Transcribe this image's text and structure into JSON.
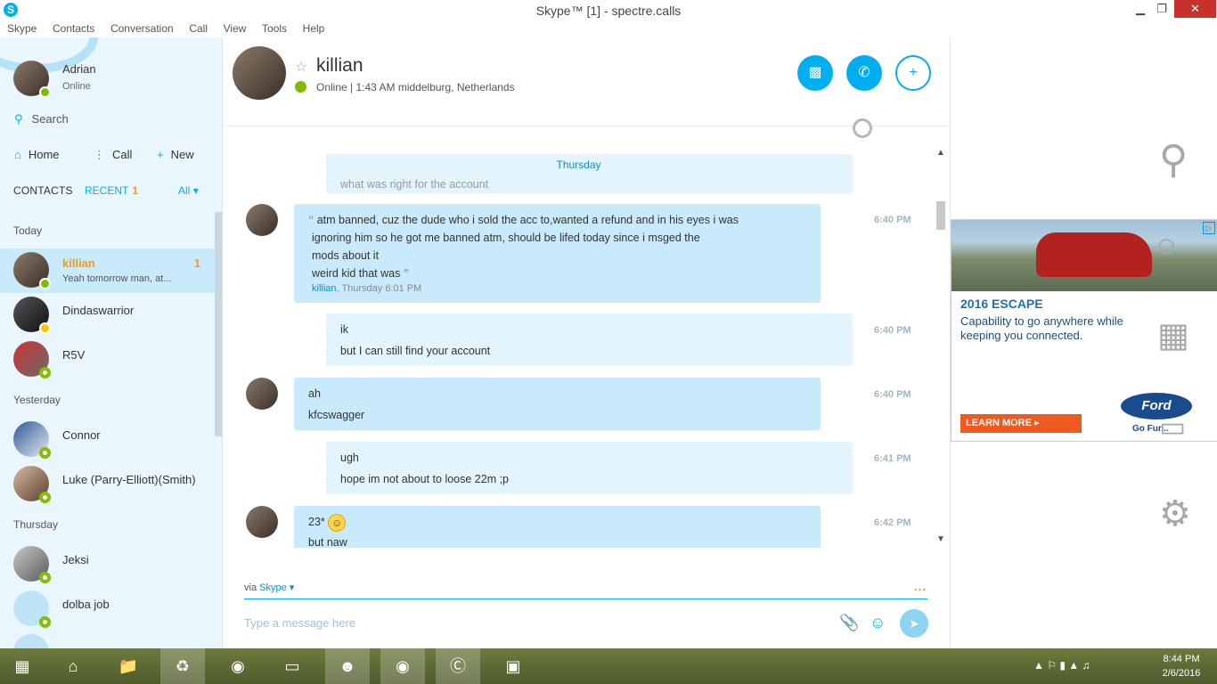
{
  "window": {
    "title": "Skype™ [1] - spectre.calls",
    "minimize": "▁",
    "maximize": "❐",
    "close": "✕"
  },
  "menu": [
    "Skype",
    "Contacts",
    "Conversation",
    "Call",
    "View",
    "Tools",
    "Help"
  ],
  "me": {
    "name": "Adrian",
    "status": "Online"
  },
  "search": {
    "label": "Search"
  },
  "nav": {
    "home": "Home",
    "call": "Call",
    "new": "New"
  },
  "tabs": {
    "contacts": "CONTACTS",
    "recent": "RECENT",
    "recent_count": "1",
    "filter": "All"
  },
  "sections": {
    "today": "Today",
    "yesterday": "Yesterday",
    "thursday": "Thursday"
  },
  "contacts": [
    {
      "name": "killian",
      "preview": "Yeah tomorrow man, at...",
      "badge": "1",
      "status": "online"
    },
    {
      "name": "Dindaswarrior",
      "status": "away"
    },
    {
      "name": "R5V",
      "status": "offline"
    },
    {
      "name": "Connor",
      "status": "offline"
    },
    {
      "name": "Luke (Parry-Elliott)(Smith)",
      "status": "offline"
    },
    {
      "name": "Jeksi",
      "status": "offline"
    },
    {
      "name": "dolba job",
      "status": "offline"
    }
  ],
  "conversation": {
    "name": "killian",
    "status": "Online",
    "detail": "1:43 AM middelburg, Netherlands",
    "day_label": "Thursday",
    "partial_top": "what was right for the account",
    "messages": [
      {
        "from": "them",
        "lines": [
          "atm banned, cuz the dude who i sold the acc to,wanted a refund and in his eyes i was",
          "ignoring him so he got me banned atm, should be lifed today since i msged the",
          "mods about it",
          "weird kid that was"
        ],
        "quote_author": "killian",
        "quote_time": "Thursday 6:01 PM",
        "time": "6:40 PM"
      },
      {
        "from": "me",
        "lines": [
          "ik",
          "but I can still find your account"
        ],
        "time": "6:40 PM"
      },
      {
        "from": "them",
        "lines": [
          "ah",
          "kfcswagger"
        ],
        "time": "6:40 PM"
      },
      {
        "from": "me",
        "lines": [
          "ugh",
          "hope im not about to loose 22m ;p"
        ],
        "time": "6:41 PM"
      },
      {
        "from": "them",
        "lines": [
          "23*",
          "but naw"
        ],
        "time": "6:42 PM"
      }
    ]
  },
  "compose": {
    "via": "via",
    "via_service": "Skype",
    "placeholder": "Type a message here",
    "more": "..."
  },
  "ad": {
    "headline": "2016 ESCAPE",
    "copy": "Capability to go anywhere while keeping you connected.",
    "cta": "LEARN MORE",
    "brand": "Ford",
    "tagline": "Go Fur..."
  },
  "taskbar": {
    "time": "8:44 PM",
    "date": "2/6/2016"
  }
}
